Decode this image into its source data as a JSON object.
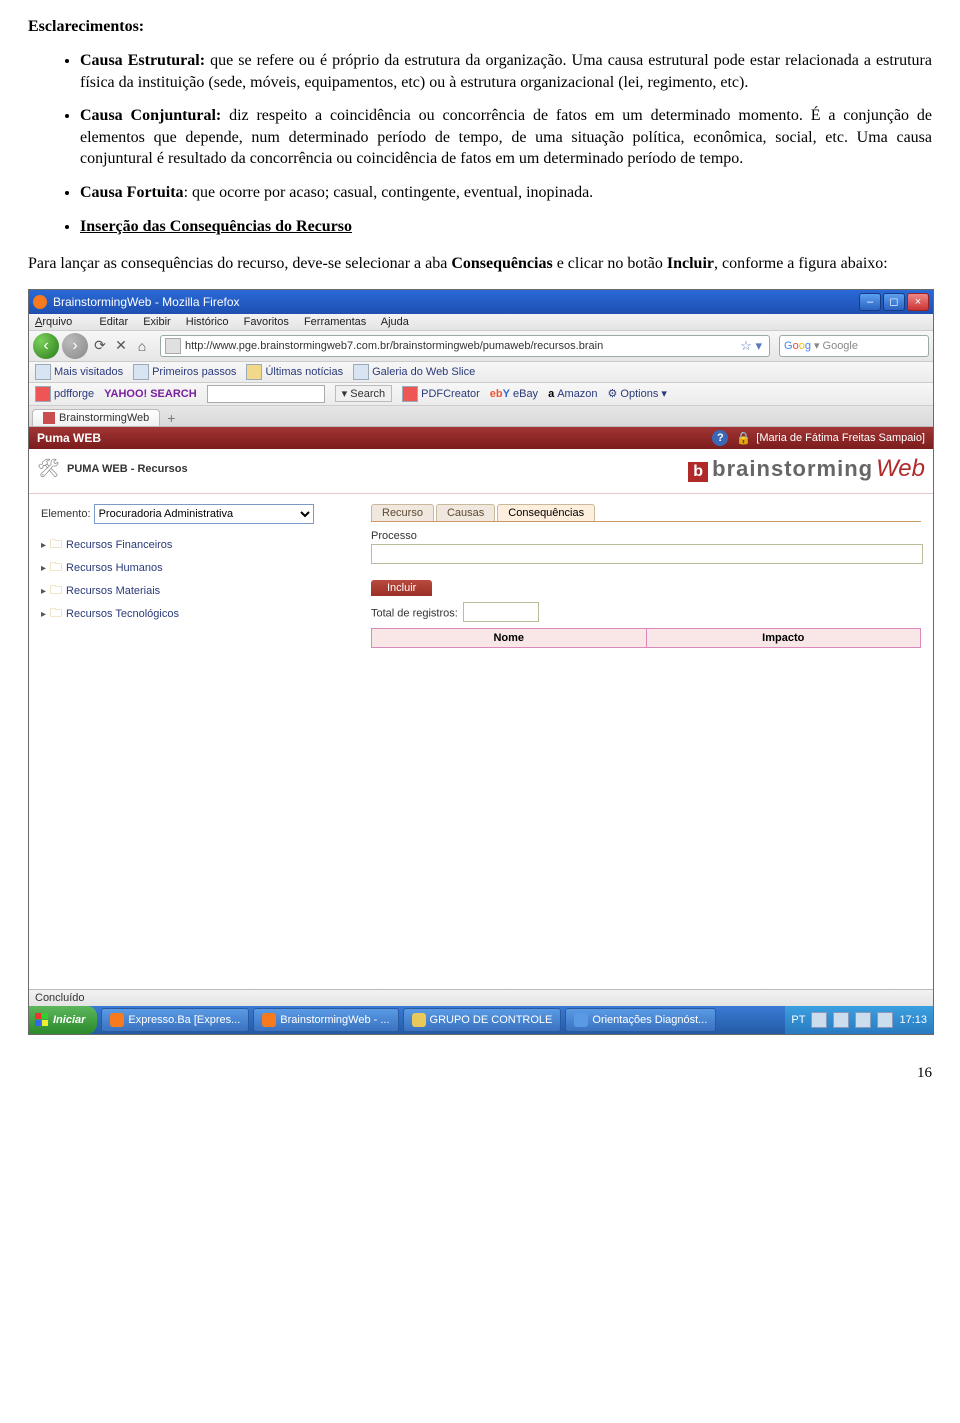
{
  "doc": {
    "heading": "Esclarecimentos:",
    "bullets": [
      {
        "label": "Causa Estrutural:",
        "text": " que se refere ou é próprio da estrutura da organização. Uma causa estrutural pode estar relacionada a estrutura física da instituição (sede, móveis, equipamentos, etc) ou à estrutura organizacional (lei, regimento, etc)."
      },
      {
        "label": "Causa Conjuntural:",
        "text": " diz respeito a coincidência ou concorrência de fatos em um determinado momento. É a conjunção de elementos que depende, num determinado período de tempo, de uma situação política, econômica, social, etc. Uma causa conjuntural é resultado da concorrência ou coincidência de fatos em um determinado período de tempo."
      },
      {
        "label": "Causa Fortuita",
        "text": ": que ocorre por acaso; casual, contingente, eventual, inopinada."
      },
      {
        "label_u": "Inserção das Consequências do Recurso"
      }
    ],
    "para_pre": "Para lançar as consequências do recurso, deve-se selecionar a aba ",
    "para_bold": "Consequências",
    "para_mid": " e clicar no botão ",
    "para_bold2": "Incluir",
    "para_post": ", conforme a figura abaixo:",
    "page_number": "16"
  },
  "shot": {
    "title": "BrainstormingWeb - Mozilla Firefox",
    "menu": {
      "arquivo": "Arquivo",
      "editar": "Editar",
      "exibir": "Exibir",
      "historico": "Histórico",
      "favoritos": "Favoritos",
      "ferramentas": "Ferramentas",
      "ajuda": "Ajuda"
    },
    "url": "http://www.pge.brainstormingweb7.com.br/brainstormingweb/pumaweb/recursos.brain",
    "search_placeholder": "Google",
    "bookmarks": [
      "Mais visitados",
      "Primeiros passos",
      "Últimas notícias",
      "Galeria do Web Slice"
    ],
    "toolbar": {
      "pdfforge": "pdfforge",
      "yahoo": "YAHOO! SEARCH",
      "search_btn": "Search",
      "pdfcreator": "PDFCreator",
      "ebay": "eBay",
      "amazon": "Amazon",
      "options": "Options"
    },
    "tab_label": "BrainstormingWeb",
    "puma": {
      "title": "Puma WEB",
      "user": "[Maria de Fátima Freitas Sampaio]"
    },
    "app": {
      "title": "PUMA WEB - Recursos",
      "brand_bs": "brainstorming",
      "brand_web": "Web",
      "elemento_label": "Elemento:",
      "elemento_value": "Procuradoria Administrativa",
      "tree": [
        "Recursos Financeiros",
        "Recursos Humanos",
        "Recursos Materiais",
        "Recursos Tecnológicos"
      ],
      "tabs": [
        "Recurso",
        "Causas",
        "Consequências"
      ],
      "processo": "Processo",
      "incluir": "Incluir",
      "total": "Total de registros:",
      "grid": [
        "Nome",
        "Impacto"
      ]
    },
    "status": "Concluído",
    "taskbar": {
      "start": "Iniciar",
      "items": [
        "Expresso.Ba [Expres...",
        "BrainstormingWeb - ...",
        "GRUPO DE CONTROLE",
        "Orientações Diagnóst..."
      ],
      "lang": "PT",
      "time": "17:13"
    }
  }
}
